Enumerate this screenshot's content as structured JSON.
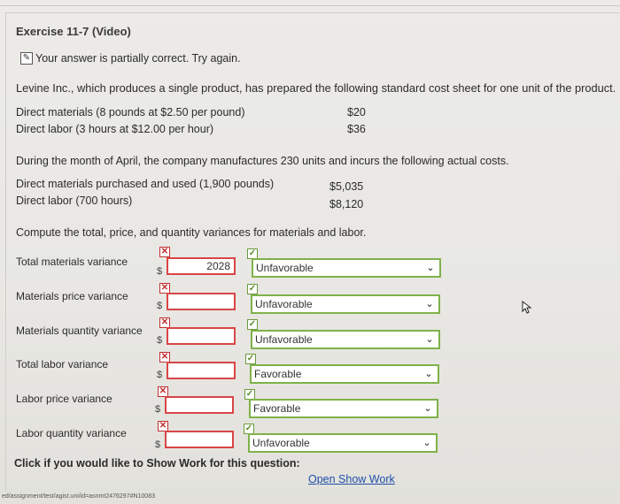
{
  "header": {
    "title": "Exercise 11-7 (Video)",
    "status_message": "Your answer is partially correct.  Try again."
  },
  "problem": {
    "intro": "Levine Inc., which produces a single product, has prepared the following standard cost sheet for one unit of the product.",
    "standard_cost": [
      {
        "label": "Direct materials (8 pounds at $2.50 per pound)",
        "value": "$20"
      },
      {
        "label": "Direct labor (3 hours at $12.00 per hour)",
        "value": "$36"
      }
    ],
    "april_text": "During the month of April, the company manufactures 230 units and incurs the following actual costs.",
    "actual_costs": [
      {
        "label": "Direct materials purchased and used (1,900 pounds)",
        "value": "$5,035"
      },
      {
        "label": "Direct labor (700 hours)",
        "value": "$8,120"
      }
    ],
    "instruction": "Compute the total, price, and quantity variances for materials and labor."
  },
  "variances": [
    {
      "label": "Total materials variance",
      "currency": "$",
      "amount": "2028",
      "type": "Unfavorable",
      "amount_correct": false,
      "type_correct": true
    },
    {
      "label": "Materials price variance",
      "currency": "$",
      "amount": "",
      "type": "Unfavorable",
      "amount_correct": false,
      "type_correct": true
    },
    {
      "label": "Materials quantity variance",
      "currency": "$",
      "amount": "",
      "type": "Unfavorable",
      "amount_correct": false,
      "type_correct": true
    },
    {
      "label": "Total labor variance",
      "currency": "$",
      "amount": "",
      "type": "Favorable",
      "amount_correct": false,
      "type_correct": true
    },
    {
      "label": "Labor price variance",
      "currency": "$",
      "amount": "",
      "type": "Favorable",
      "amount_correct": false,
      "type_correct": true
    },
    {
      "label": "Labor quantity variance",
      "currency": "$",
      "amount": "",
      "type": "Unfavorable",
      "amount_correct": false,
      "type_correct": true
    }
  ],
  "icons": {
    "pencil": "✎",
    "x": "✕",
    "check": "✓",
    "chevron": "❯"
  },
  "footer": {
    "prompt": "Click if you would like to Show Work for this question:",
    "link": "Open Show Work",
    "status_url": "ed/assignment/test/agist.uni/id=asnmt2476297#N10083"
  },
  "colors": {
    "incorrect": "#d94545",
    "correct": "#7fb24a",
    "link": "#1f4fa8"
  }
}
